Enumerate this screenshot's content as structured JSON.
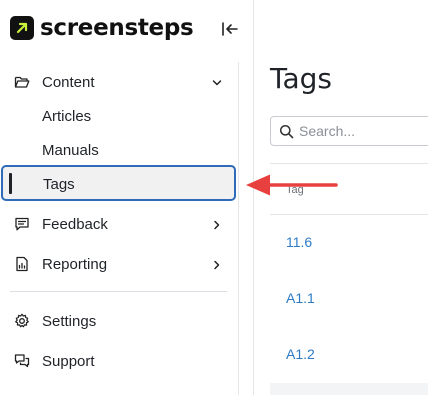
{
  "brand": {
    "name": "screensteps"
  },
  "sidebar": {
    "items": [
      {
        "label": "Content",
        "icon": "folder-open-icon",
        "expanded": true
      },
      {
        "label": "Articles"
      },
      {
        "label": "Manuals"
      },
      {
        "label": "Tags",
        "active": true
      },
      {
        "label": "Feedback",
        "icon": "message-square-icon"
      },
      {
        "label": "Reporting",
        "icon": "report-chart-icon"
      },
      {
        "label": "Settings",
        "icon": "gear-icon"
      },
      {
        "label": "Support",
        "icon": "chat-bubbles-icon"
      }
    ]
  },
  "main": {
    "title": "Tags",
    "search": {
      "placeholder": "Search...",
      "value": ""
    },
    "table": {
      "column": "Tag",
      "rows": [
        "11.6",
        "A1.1",
        "A1.2"
      ]
    }
  },
  "colors": {
    "accent": "#2e6bb8",
    "link": "#2d7bc6",
    "annotation_arrow": "#e8403f"
  }
}
